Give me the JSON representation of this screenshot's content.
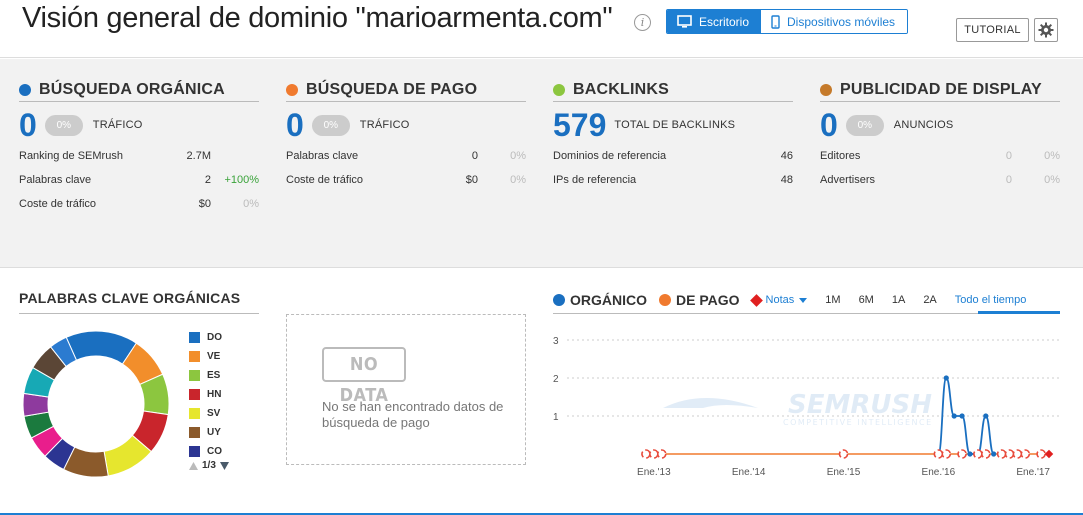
{
  "header": {
    "title": "Visión general de dominio \"marioarmenta.com\"",
    "info_icon": "info-icon",
    "device_desktop": "Escritorio",
    "device_mobile": "Dispositivos móviles",
    "tutorial": "TUTORIAL",
    "settings_icon": "gear-icon"
  },
  "organic": {
    "title": "BÚSQUEDA ORGÁNICA",
    "color": "#1a6fc0",
    "value": "0",
    "pct": "0%",
    "value_label": "TRÁFICO",
    "rows": [
      {
        "label": "Ranking de SEMrush",
        "v1": "2.7M",
        "v2": ""
      },
      {
        "label": "Palabras clave",
        "v1": "2",
        "v2": "+100%"
      },
      {
        "label": "Coste de tráfico",
        "v1": "$0",
        "v2": "0%"
      }
    ]
  },
  "paid": {
    "title": "BÚSQUEDA DE PAGO",
    "color": "#f07a2e",
    "value": "0",
    "pct": "0%",
    "value_label": "TRÁFICO",
    "rows": [
      {
        "label": "Palabras clave",
        "v1": "0",
        "v2": "0%"
      },
      {
        "label": "Coste de tráfico",
        "v1": "$0",
        "v2": "0%"
      }
    ]
  },
  "backlinks": {
    "title": "BACKLINKS",
    "color": "#8cc63f",
    "value": "579",
    "value_label": "TOTAL DE BACKLINKS",
    "rows": [
      {
        "label": "Dominios de referencia",
        "v1": "46"
      },
      {
        "label": "IPs de referencia",
        "v1": "48"
      }
    ]
  },
  "display": {
    "title": "PUBLICIDAD DE DISPLAY",
    "color": "#c57a2a",
    "value": "0",
    "pct": "0%",
    "value_label": "ANUNCIOS",
    "rows": [
      {
        "label": "Editores",
        "v1": "0",
        "v2": "0%"
      },
      {
        "label": "Advertisers",
        "v1": "0",
        "v2": "0%"
      }
    ]
  },
  "keywords": {
    "title": "PALABRAS CLAVE ORGÁNICAS",
    "legend": [
      {
        "code": "DO",
        "color": "#1a6fc0"
      },
      {
        "code": "VE",
        "color": "#f28e2b"
      },
      {
        "code": "ES",
        "color": "#8cc63f"
      },
      {
        "code": "HN",
        "color": "#c9252c"
      },
      {
        "code": "SV",
        "color": "#e6e62e"
      },
      {
        "code": "UY",
        "color": "#8b5a2b"
      },
      {
        "code": "CO",
        "color": "#2c3592"
      }
    ],
    "donut": [
      {
        "code": "DO",
        "share": 0.16,
        "color": "#1a6fc0"
      },
      {
        "code": "VE",
        "share": 0.09,
        "color": "#f28e2b"
      },
      {
        "code": "ES",
        "share": 0.09,
        "color": "#8cc63f"
      },
      {
        "code": "HN",
        "share": 0.09,
        "color": "#c9252c"
      },
      {
        "code": "SV",
        "share": 0.11,
        "color": "#e6e62e"
      },
      {
        "code": "UY",
        "share": 0.1,
        "color": "#8b5a2b"
      },
      {
        "code": "CO",
        "share": 0.05,
        "color": "#2c3592"
      },
      {
        "code": "",
        "share": 0.05,
        "color": "#e91e8c"
      },
      {
        "code": "",
        "share": 0.05,
        "color": "#1b7a3e"
      },
      {
        "code": "",
        "share": 0.05,
        "color": "#8e3a9e"
      },
      {
        "code": "",
        "share": 0.06,
        "color": "#17a9b5"
      },
      {
        "code": "",
        "share": 0.06,
        "color": "#5b4636"
      },
      {
        "code": "",
        "share": 0.04,
        "color": "#2b7bd0"
      }
    ],
    "pager": "1/3"
  },
  "nodata": {
    "badge": "NO DATA",
    "text": "No se han encontrado datos de búsqueda de pago"
  },
  "trend": {
    "organic_label": "ORGÁNICO",
    "paid_label": "DE PAGO",
    "notes_label": "Notas",
    "ranges": [
      "1M",
      "6M",
      "1A",
      "2A",
      "Todo el tiempo"
    ],
    "active_range": "Todo el tiempo",
    "watermark": "SEMRUSH",
    "watermark_sub": "COMPETITIVE INTELLIGENCE"
  },
  "chart_data": {
    "type": "line",
    "title": "",
    "xlabel": "",
    "ylabel": "",
    "ylim": [
      0,
      3
    ],
    "yticks": [
      1,
      2,
      3
    ],
    "xticks": [
      "Ene.'13",
      "Ene.'14",
      "Ene.'15",
      "Ene.'16",
      "Ene.'17"
    ],
    "series": [
      {
        "name": "ORGÁNICO",
        "color": "#1a6fc0",
        "points": [
          {
            "x": "2016-01",
            "y": 0
          },
          {
            "x": "2016-02",
            "y": 2
          },
          {
            "x": "2016-03",
            "y": 1
          },
          {
            "x": "2016-04",
            "y": 1
          },
          {
            "x": "2016-05",
            "y": 0
          },
          {
            "x": "2016-06",
            "y": 0
          },
          {
            "x": "2016-07",
            "y": 1
          },
          {
            "x": "2016-08",
            "y": 0
          }
        ]
      },
      {
        "name": "DE PAGO",
        "color": "#f07a2e",
        "points": [
          {
            "x": "2012-12",
            "y": 0
          },
          {
            "x": "2017-03",
            "y": 0
          }
        ]
      }
    ]
  }
}
